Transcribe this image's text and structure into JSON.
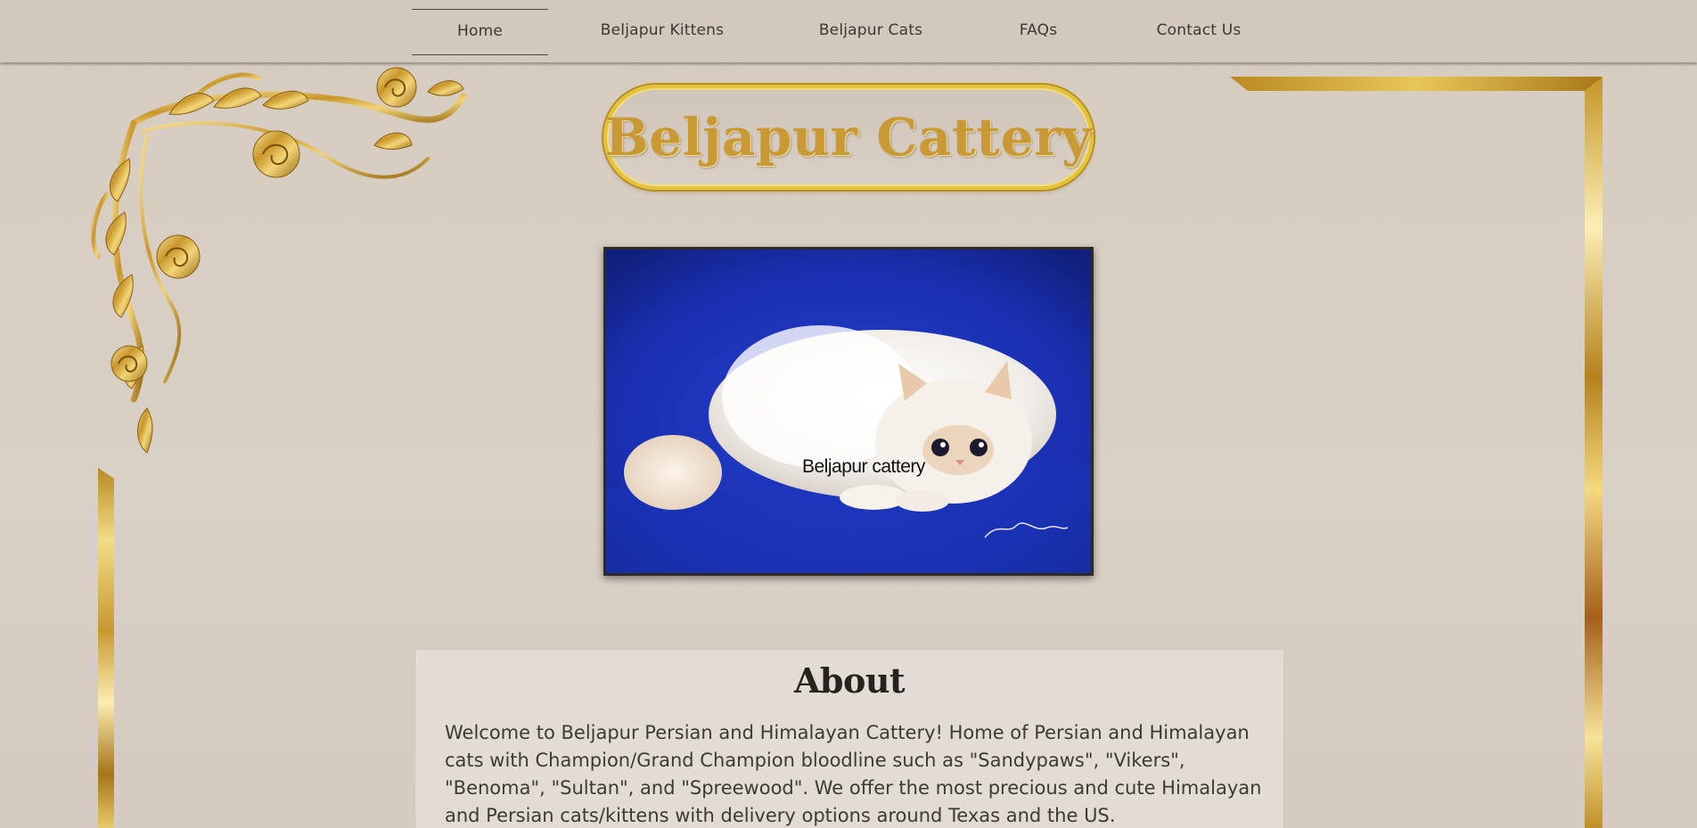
{
  "nav": {
    "items": [
      {
        "label": "Home",
        "active": true
      },
      {
        "label": "Beljapur Kittens",
        "active": false
      },
      {
        "label": "Beljapur Cats",
        "active": false
      },
      {
        "label": "FAQs",
        "active": false
      },
      {
        "label": "Contact Us",
        "active": false
      }
    ]
  },
  "header": {
    "title": "Beljapur Cattery"
  },
  "hero": {
    "caption": "Beljapur cattery"
  },
  "about": {
    "heading": "About",
    "text": "Welcome to Beljapur Persian and Himalayan Cattery! Home of Persian and Himalayan cats with Champion/Grand Champion bloodline such as \"Sandypaws\", \"Vikers\", \"Benoma\", \"Sultan\", and \"Spreewood\". We offer the most precious and cute Himalayan and Persian cats/kittens with delivery options around Texas and the US."
  },
  "colors": {
    "background": "#d8cfc4",
    "gold": "#c99a33",
    "gold_light": "#f3dc80",
    "photo_backdrop": "#1a33b8"
  },
  "icons": {
    "ornament": "gold-floral-corner-ornament",
    "frame": "gold-frame-border"
  }
}
